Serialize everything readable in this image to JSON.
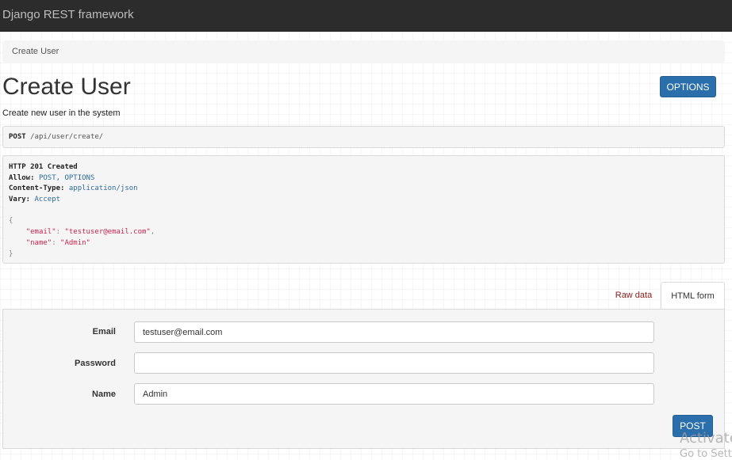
{
  "navbar": {
    "brand": "Django REST framework"
  },
  "breadcrumb": {
    "items": [
      "Create User"
    ]
  },
  "header": {
    "title": "Create User",
    "options_label": "OPTIONS",
    "description": "Create new user in the system"
  },
  "request": {
    "method": "POST",
    "url": "/api/user/create/"
  },
  "response": {
    "status": "HTTP 201 Created",
    "headers": [
      {
        "key": "Allow:",
        "value": "POST, OPTIONS"
      },
      {
        "key": "Content-Type:",
        "value": "application/json"
      },
      {
        "key": "Vary:",
        "value": "Accept"
      }
    ],
    "body": {
      "open": "{",
      "close": "}",
      "fields": [
        {
          "key": "\"email\"",
          "value": "\"testuser@email.com\"",
          "trail": ","
        },
        {
          "key": "\"name\"",
          "value": "\"Admin\"",
          "trail": ""
        }
      ]
    }
  },
  "tabs": {
    "raw": "Raw data",
    "html": "HTML form"
  },
  "form": {
    "fields": [
      {
        "label": "Email",
        "value": "testuser@email.com"
      },
      {
        "label": "Password",
        "value": ""
      },
      {
        "label": "Name",
        "value": "Admin"
      }
    ],
    "submit_label": "POST"
  },
  "watermark": {
    "line1": "Activate",
    "line2": "Go to Sett"
  },
  "colors": {
    "navbar_bg": "#2c2c2c",
    "primary_button": "#2a6fac",
    "raw_tab_text": "#8b1a1a",
    "header_value": "#2f6b9a",
    "json_string": "#c7254e"
  }
}
